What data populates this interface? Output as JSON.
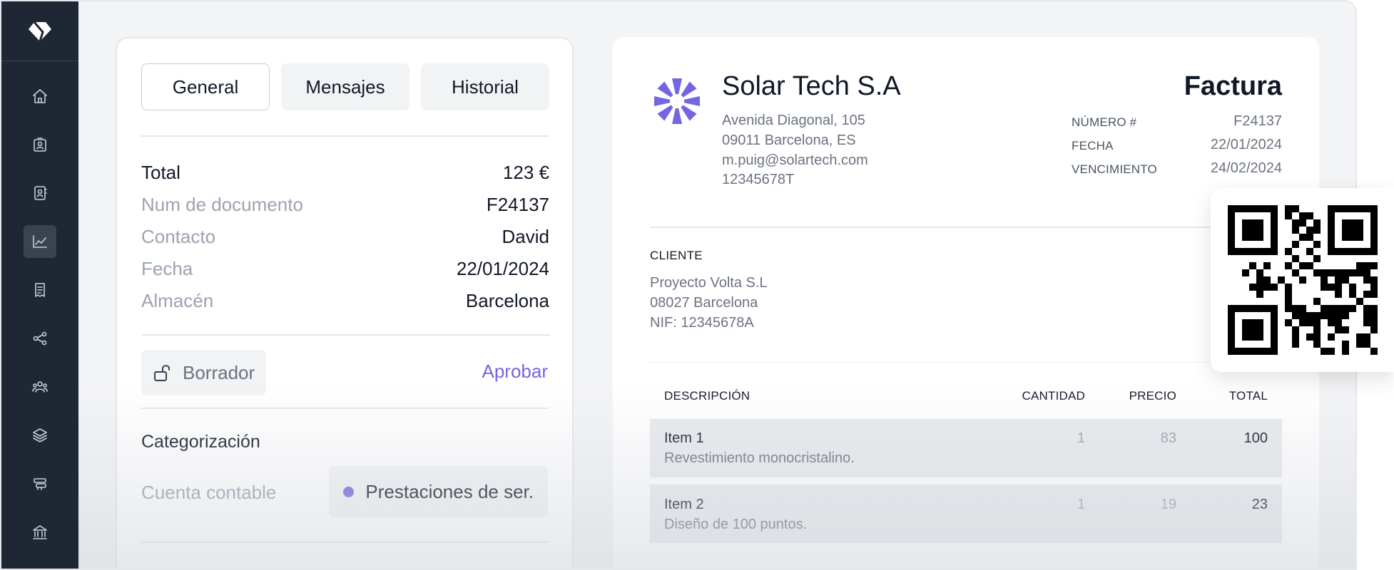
{
  "sidebar": {
    "items": [
      {
        "icon": "home-icon"
      },
      {
        "icon": "contact-card-icon"
      },
      {
        "icon": "address-book-icon"
      },
      {
        "icon": "chart-icon",
        "active": true
      },
      {
        "icon": "receipt-icon"
      },
      {
        "icon": "share-icon"
      },
      {
        "icon": "users-icon"
      },
      {
        "icon": "layers-icon"
      },
      {
        "icon": "stack-icon"
      },
      {
        "icon": "bank-icon"
      }
    ]
  },
  "tabs": [
    "General",
    "Mensajes",
    "Historial"
  ],
  "details": {
    "total": {
      "label": "Total",
      "value": "123 €"
    },
    "doc_num": {
      "label": "Num de documento",
      "value": "F24137"
    },
    "contact": {
      "label": "Contacto",
      "value": "David"
    },
    "date": {
      "label": "Fecha",
      "value": "22/01/2024"
    },
    "warehouse": {
      "label": "Almacén",
      "value": "Barcelona"
    }
  },
  "status": {
    "label": "Borrador",
    "action": "Aprobar"
  },
  "categorization": {
    "title": "Categorización",
    "account_label": "Cuenta contable",
    "account_value": "Prestaciones de ser."
  },
  "invoice": {
    "company": "Solar Tech S.A",
    "address": [
      "Avenida Diagonal, 105",
      "09011 Barcelona, ES",
      "m.puig@solartech.com",
      "12345678T"
    ],
    "title": "Factura",
    "meta": [
      {
        "label": "NÚMERO #",
        "value": "F24137"
      },
      {
        "label": "FECHA",
        "value": "22/01/2024"
      },
      {
        "label": "VENCIMIENTO",
        "value": "24/02/2024"
      }
    ],
    "client_title": "CLIENTE",
    "client": [
      "Proyecto Volta S.L",
      "08027 Barcelona",
      "NIF: 12345678A"
    ],
    "columns": {
      "desc": "DESCRIPCIÓN",
      "qty": "CANTIDAD",
      "price": "PRECIO",
      "total": "TOTAL"
    },
    "items": [
      {
        "name": "Item 1",
        "desc": "Revestimiento monocristalino.",
        "qty": "1",
        "price": "83",
        "total": "100"
      },
      {
        "name": "Item 2",
        "desc": "Diseño de 100 puntos.",
        "qty": "1",
        "price": "19",
        "total": "23"
      }
    ]
  },
  "colors": {
    "accent": "#7466e0",
    "sidebar": "#1e2733"
  }
}
